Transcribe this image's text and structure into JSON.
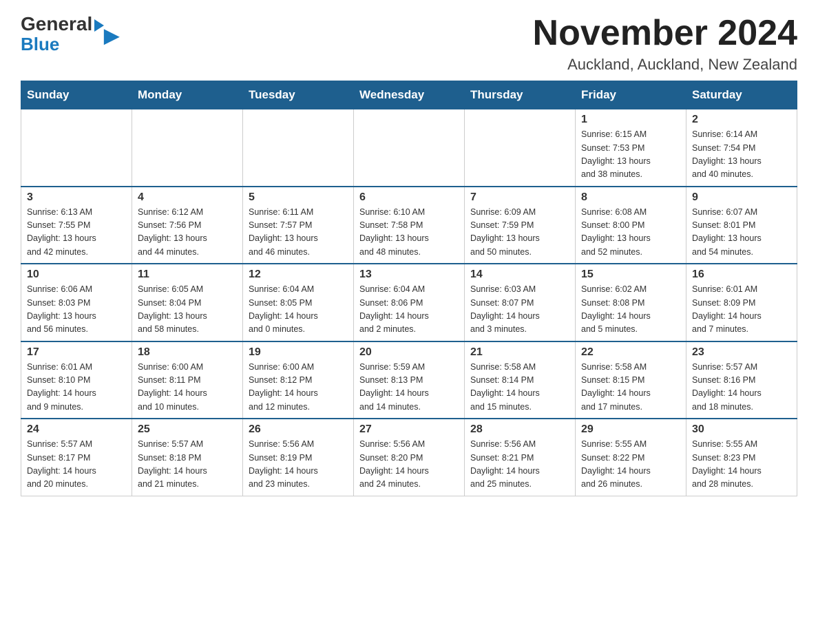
{
  "header": {
    "logo_general": "General",
    "logo_blue": "Blue",
    "month_title": "November 2024",
    "location": "Auckland, Auckland, New Zealand"
  },
  "weekdays": [
    "Sunday",
    "Monday",
    "Tuesday",
    "Wednesday",
    "Thursday",
    "Friday",
    "Saturday"
  ],
  "weeks": [
    [
      {
        "day": "",
        "info": ""
      },
      {
        "day": "",
        "info": ""
      },
      {
        "day": "",
        "info": ""
      },
      {
        "day": "",
        "info": ""
      },
      {
        "day": "",
        "info": ""
      },
      {
        "day": "1",
        "info": "Sunrise: 6:15 AM\nSunset: 7:53 PM\nDaylight: 13 hours\nand 38 minutes."
      },
      {
        "day": "2",
        "info": "Sunrise: 6:14 AM\nSunset: 7:54 PM\nDaylight: 13 hours\nand 40 minutes."
      }
    ],
    [
      {
        "day": "3",
        "info": "Sunrise: 6:13 AM\nSunset: 7:55 PM\nDaylight: 13 hours\nand 42 minutes."
      },
      {
        "day": "4",
        "info": "Sunrise: 6:12 AM\nSunset: 7:56 PM\nDaylight: 13 hours\nand 44 minutes."
      },
      {
        "day": "5",
        "info": "Sunrise: 6:11 AM\nSunset: 7:57 PM\nDaylight: 13 hours\nand 46 minutes."
      },
      {
        "day": "6",
        "info": "Sunrise: 6:10 AM\nSunset: 7:58 PM\nDaylight: 13 hours\nand 48 minutes."
      },
      {
        "day": "7",
        "info": "Sunrise: 6:09 AM\nSunset: 7:59 PM\nDaylight: 13 hours\nand 50 minutes."
      },
      {
        "day": "8",
        "info": "Sunrise: 6:08 AM\nSunset: 8:00 PM\nDaylight: 13 hours\nand 52 minutes."
      },
      {
        "day": "9",
        "info": "Sunrise: 6:07 AM\nSunset: 8:01 PM\nDaylight: 13 hours\nand 54 minutes."
      }
    ],
    [
      {
        "day": "10",
        "info": "Sunrise: 6:06 AM\nSunset: 8:03 PM\nDaylight: 13 hours\nand 56 minutes."
      },
      {
        "day": "11",
        "info": "Sunrise: 6:05 AM\nSunset: 8:04 PM\nDaylight: 13 hours\nand 58 minutes."
      },
      {
        "day": "12",
        "info": "Sunrise: 6:04 AM\nSunset: 8:05 PM\nDaylight: 14 hours\nand 0 minutes."
      },
      {
        "day": "13",
        "info": "Sunrise: 6:04 AM\nSunset: 8:06 PM\nDaylight: 14 hours\nand 2 minutes."
      },
      {
        "day": "14",
        "info": "Sunrise: 6:03 AM\nSunset: 8:07 PM\nDaylight: 14 hours\nand 3 minutes."
      },
      {
        "day": "15",
        "info": "Sunrise: 6:02 AM\nSunset: 8:08 PM\nDaylight: 14 hours\nand 5 minutes."
      },
      {
        "day": "16",
        "info": "Sunrise: 6:01 AM\nSunset: 8:09 PM\nDaylight: 14 hours\nand 7 minutes."
      }
    ],
    [
      {
        "day": "17",
        "info": "Sunrise: 6:01 AM\nSunset: 8:10 PM\nDaylight: 14 hours\nand 9 minutes."
      },
      {
        "day": "18",
        "info": "Sunrise: 6:00 AM\nSunset: 8:11 PM\nDaylight: 14 hours\nand 10 minutes."
      },
      {
        "day": "19",
        "info": "Sunrise: 6:00 AM\nSunset: 8:12 PM\nDaylight: 14 hours\nand 12 minutes."
      },
      {
        "day": "20",
        "info": "Sunrise: 5:59 AM\nSunset: 8:13 PM\nDaylight: 14 hours\nand 14 minutes."
      },
      {
        "day": "21",
        "info": "Sunrise: 5:58 AM\nSunset: 8:14 PM\nDaylight: 14 hours\nand 15 minutes."
      },
      {
        "day": "22",
        "info": "Sunrise: 5:58 AM\nSunset: 8:15 PM\nDaylight: 14 hours\nand 17 minutes."
      },
      {
        "day": "23",
        "info": "Sunrise: 5:57 AM\nSunset: 8:16 PM\nDaylight: 14 hours\nand 18 minutes."
      }
    ],
    [
      {
        "day": "24",
        "info": "Sunrise: 5:57 AM\nSunset: 8:17 PM\nDaylight: 14 hours\nand 20 minutes."
      },
      {
        "day": "25",
        "info": "Sunrise: 5:57 AM\nSunset: 8:18 PM\nDaylight: 14 hours\nand 21 minutes."
      },
      {
        "day": "26",
        "info": "Sunrise: 5:56 AM\nSunset: 8:19 PM\nDaylight: 14 hours\nand 23 minutes."
      },
      {
        "day": "27",
        "info": "Sunrise: 5:56 AM\nSunset: 8:20 PM\nDaylight: 14 hours\nand 24 minutes."
      },
      {
        "day": "28",
        "info": "Sunrise: 5:56 AM\nSunset: 8:21 PM\nDaylight: 14 hours\nand 25 minutes."
      },
      {
        "day": "29",
        "info": "Sunrise: 5:55 AM\nSunset: 8:22 PM\nDaylight: 14 hours\nand 26 minutes."
      },
      {
        "day": "30",
        "info": "Sunrise: 5:55 AM\nSunset: 8:23 PM\nDaylight: 14 hours\nand 28 minutes."
      }
    ]
  ]
}
